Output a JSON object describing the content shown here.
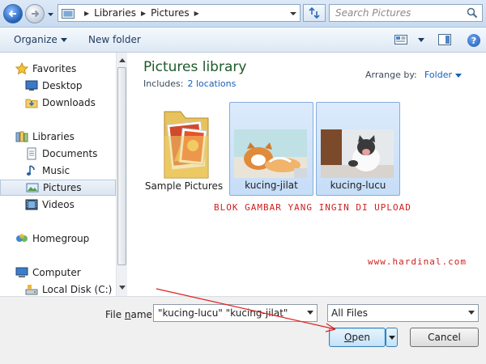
{
  "address_bar": {
    "breadcrumbs": [
      "Libraries",
      "Pictures"
    ],
    "search_placeholder": "Search Pictures"
  },
  "toolbar": {
    "organize_label": "Organize",
    "new_folder_label": "New folder"
  },
  "nav": {
    "favorites": "Favorites",
    "favorites_items": [
      "Desktop",
      "Downloads"
    ],
    "libraries": "Libraries",
    "libraries_items": [
      "Documents",
      "Music",
      "Pictures",
      "Videos"
    ],
    "homegroup": "Homegroup",
    "computer": "Computer",
    "computer_items": [
      "Local Disk (C:)"
    ],
    "selected": "Pictures"
  },
  "content": {
    "title": "Pictures library",
    "includes_label": "Includes:",
    "includes_link": "2 locations",
    "arrange_label": "Arrange by:",
    "arrange_value": "Folder",
    "items": [
      {
        "label": "Sample Pictures",
        "kind": "folder",
        "selected": false
      },
      {
        "label": "kucing-jilat",
        "kind": "image",
        "selected": true
      },
      {
        "label": "kucing-lucu",
        "kind": "image",
        "selected": true
      }
    ],
    "annotation_text": "BLOK GAMBAR YANG INGIN DI UPLOAD",
    "watermark": "www.hardinal.com"
  },
  "footer": {
    "file_name_label_pre": "File ",
    "file_name_label_u": "n",
    "file_name_label_post": "ame:",
    "file_name_value": "\"kucing-lucu\" \"kucing-jilat\"",
    "file_type": "All Files",
    "open_label_u": "O",
    "open_label_rest": "pen",
    "cancel_label": "Cancel"
  },
  "colors": {
    "annotation": "#d02020",
    "title_green": "#1e5a2a",
    "link_blue": "#1a5fb4"
  }
}
